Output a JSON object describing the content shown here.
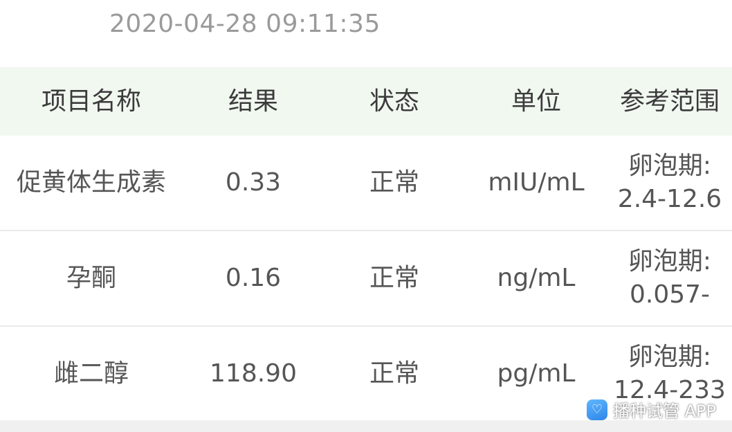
{
  "report": {
    "timestamp": "2020-04-28 09:11:35"
  },
  "table": {
    "headers": [
      "项目名称",
      "结果",
      "状态",
      "单位",
      "参考范围"
    ],
    "rows": [
      {
        "name": "促黄体生成素",
        "result": "0.33",
        "status": "正常",
        "unit": "mIU/mL",
        "range_label": "卵泡期:",
        "range_value": "2.4-12.6"
      },
      {
        "name": "孕酮",
        "result": "0.16",
        "status": "正常",
        "unit": "ng/mL",
        "range_label": "卵泡期:",
        "range_value": "0.057-"
      },
      {
        "name": "雌二醇",
        "result": "118.90",
        "status": "正常",
        "unit": "pg/mL",
        "range_label": "卵泡期:",
        "range_value": "12.4-233"
      }
    ]
  },
  "watermark": {
    "icon": "app-logo-icon",
    "text": "播种试管 APP"
  },
  "colors": {
    "header_bg": "#f1f8f0",
    "text": "#555555",
    "timestamp": "#9a9a9a"
  }
}
